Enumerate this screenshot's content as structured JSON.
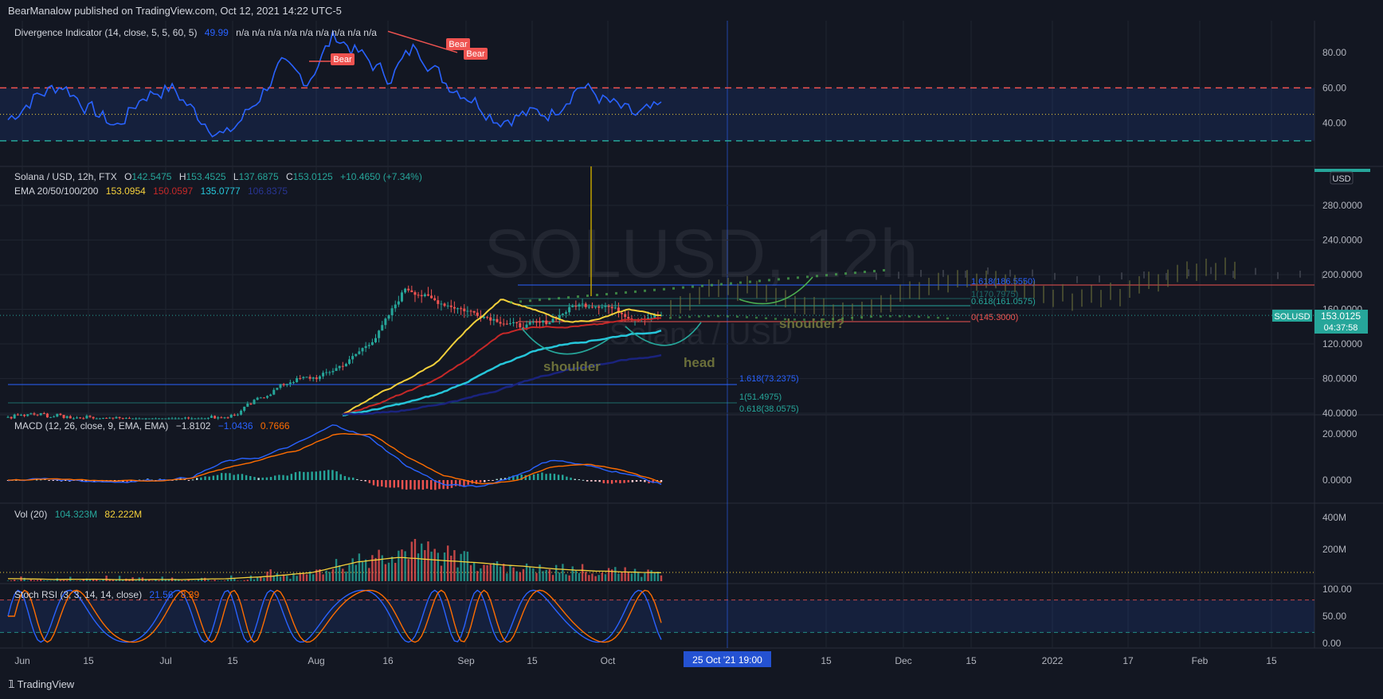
{
  "header": {
    "publisher": "BearManalow published on TradingView.com, Oct 12, 2021 14:22 UTC-5"
  },
  "footer": {
    "brand": "TradingView",
    "logo_icon": "tradingview-logo-icon"
  },
  "colors": {
    "bg": "#131722",
    "grid": "#1f2430",
    "up": "#26a69a",
    "down": "#ef5350",
    "rsi_line": "#2962ff",
    "ema20": "#f5d13b",
    "ema50": "#c62828",
    "ema100": "#26c6da",
    "ema200": "#1a237e",
    "macd": "#2962ff",
    "signal": "#ff6d00",
    "vol_ma": "#f5d13b",
    "stoch_k": "#2962ff",
    "stoch_d": "#ff6d00"
  },
  "panes": {
    "divergence": {
      "legend_title": "Divergence Indicator (14, close, 5, 5, 60, 5)",
      "value": "49.99",
      "na_values": "n/a n/a n/a n/a n/a n/a n/a n/a n/a",
      "axis_ticks": [
        "80.00",
        "60.00",
        "40.00"
      ],
      "upper_band": 60,
      "lower_band": 30,
      "bear_label": "Bear"
    },
    "main": {
      "legend_symbol": "Solana / USD, 12h, FTX",
      "ohlc": {
        "O": "142.5475",
        "H": "153.4525",
        "L": "137.6875",
        "C": "153.0125",
        "chg": "+10.4650 (+7.34%)"
      },
      "ema_title": "EMA 20/50/100/200",
      "ema_values": [
        "153.0954",
        "150.0597",
        "135.0777",
        "106.8375"
      ],
      "watermark": "SOLUSD, 12h",
      "watermark_sub": "Solana / USD",
      "currency": "USD",
      "axis_ticks": [
        "280.0000",
        "240.0000",
        "200.0000",
        "160.0000",
        "120.0000",
        "80.0000",
        "40.0000"
      ],
      "price_label": "SOLUSD",
      "last_price": "153.0125",
      "countdown": "04:37:58",
      "fib_upper": [
        "1.618(186.5550)",
        "1(170.7975)",
        "0.618(161.0575)",
        "0(145.3000)"
      ],
      "fib_lower": [
        "1.618(73.2375)",
        "1(51.4975)",
        "0.618(38.0575)"
      ],
      "annotations": {
        "left_shoulder": "shoulder",
        "head": "head",
        "right_shoulder": "shoulder?"
      }
    },
    "macd": {
      "legend_title": "MACD (12, 26, close, 9, EMA, EMA)",
      "values": [
        "−1.8102",
        "−1.0436",
        "0.7666"
      ],
      "axis_ticks": [
        "20.0000",
        "0.0000"
      ]
    },
    "volume": {
      "legend_title": "Vol (20)",
      "values": [
        "104.323M",
        "82.222M"
      ],
      "axis_ticks": [
        "400M",
        "200M"
      ]
    },
    "stoch_rsi": {
      "legend_title": "Stoch RSI (3, 3, 14, 14, close)",
      "values": [
        "21.56",
        "8.39"
      ],
      "axis_ticks": [
        "100.00",
        "50.00",
        "0.00"
      ],
      "upper_band": 80,
      "lower_band": 20
    }
  },
  "time_axis": {
    "labels": [
      "Jun",
      "15",
      "Jul",
      "15",
      "Aug",
      "16",
      "Sep",
      "15",
      "Oct",
      "15",
      "Dec",
      "15",
      "2022",
      "17",
      "Feb",
      "15"
    ],
    "cursor_label": "25 Oct '21   19:00"
  },
  "chart_data": {
    "type": "line",
    "instrument": "Solana / USD, 12h, FTX",
    "x": [
      "2021-06-01",
      "2021-06-15",
      "2021-07-01",
      "2021-07-15",
      "2021-08-01",
      "2021-08-16",
      "2021-09-01",
      "2021-09-15",
      "2021-10-01",
      "2021-10-12"
    ],
    "series": [
      {
        "name": "Solana / USD",
        "values": [
          36,
          37,
          34,
          30,
          38,
          72,
          110,
          152,
          145,
          153
        ]
      },
      {
        "name": "EMA 20/50/100/200",
        "values": [
          36,
          36,
          35,
          33,
          36,
          62,
          98,
          150,
          148,
          153
        ]
      }
    ],
    "ylim": [
      40,
      320
    ]
  }
}
